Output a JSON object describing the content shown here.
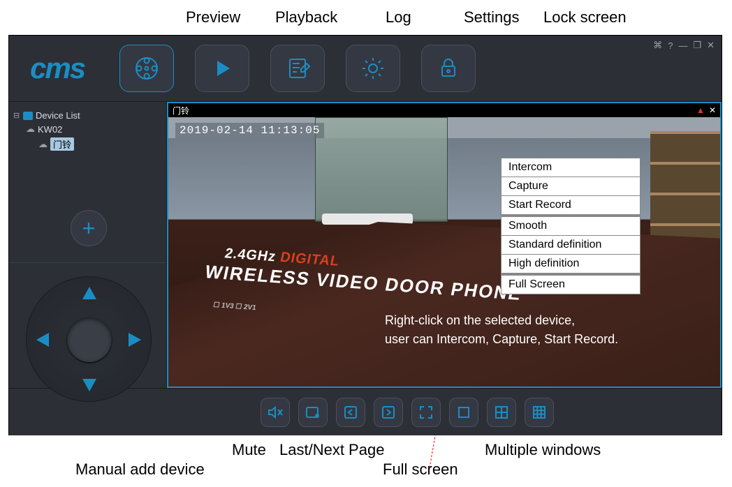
{
  "annotations": {
    "preview": "Preview",
    "playback": "Playback",
    "log": "Log",
    "settings": "Settings",
    "lock": "Lock screen",
    "manual_add": "Manual add device",
    "mute": "Mute",
    "page": "Last/Next Page",
    "fullscreen_lbl": "Full screen",
    "multi": "Multiple windows"
  },
  "logo": "cms",
  "window": {
    "monitor": "⌘",
    "help": "?",
    "min": "—",
    "max": "❐",
    "close": "✕"
  },
  "sidebar": {
    "root": "Device List",
    "group": "KW02",
    "camera": "门铃"
  },
  "add_plus": "+",
  "video": {
    "title": "门铃",
    "alert": "▲",
    "close": "✕",
    "osd": "2019-02-14  11:13:05",
    "box_line1_a": "2.4GHz ",
    "box_line1_b": "DIGITAL",
    "box_line2": "WIRELESS VIDEO DOOR PHONE",
    "box_line3": "☐ 1V3   ☐ 2V1"
  },
  "context_menu": [
    "Intercom",
    "Capture",
    "Start Record",
    "Smooth",
    "Standard definition",
    "High definition",
    "Full Screen"
  ],
  "hint_line1": "Right-click on the selected device,",
  "hint_line2": "user can Intercom, Capture, Start Record."
}
